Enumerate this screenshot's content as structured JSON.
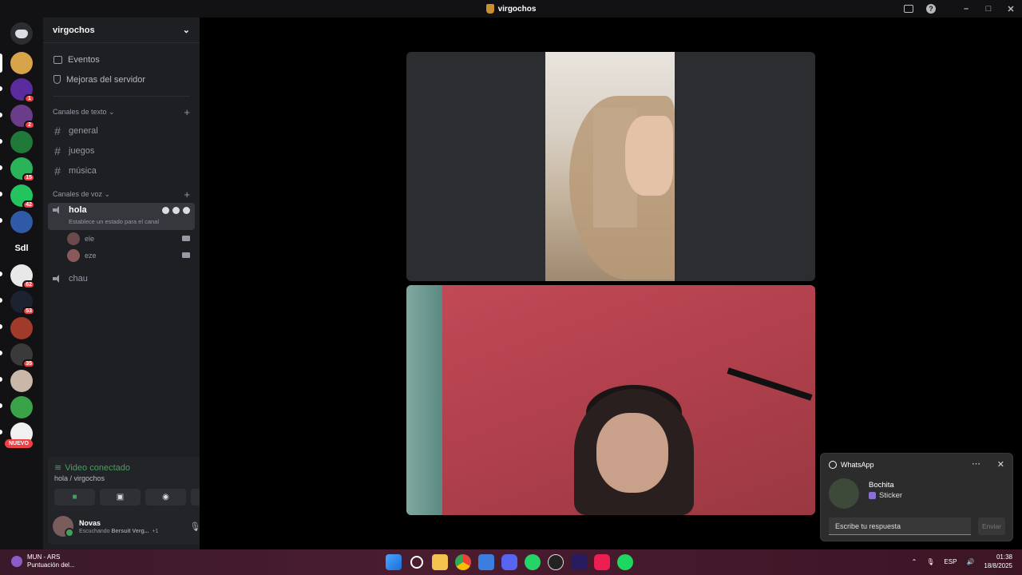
{
  "window": {
    "title": "virgochos"
  },
  "servers": {
    "badges": [
      "1",
      "2",
      "15",
      "42",
      "62",
      "53",
      "35"
    ],
    "text_server": "Sdl",
    "new_label": "NUEVO"
  },
  "sidebar": {
    "server_name": "virgochos",
    "nav": [
      {
        "label": "Eventos"
      },
      {
        "label": "Mejoras del servidor"
      }
    ],
    "text_category": "Canales de texto",
    "text_channels": [
      "general",
      "juegos",
      "música"
    ],
    "voice_category": "Canales de voz",
    "active_voice": {
      "name": "hola",
      "status": "Establece un estado para el canal"
    },
    "voice_users": [
      "ele",
      "eze"
    ],
    "voice_channel2": "chau"
  },
  "voice_panel": {
    "title": "Video conectado",
    "subtitle": "hola / virgochos",
    "user_name": "Novas",
    "user_status_prefix": "Escuchando",
    "user_status_track": "Bersuit Verg...",
    "user_status_extra": "+1"
  },
  "toast": {
    "app": "WhatsApp",
    "sender": "Bochita",
    "message": "Sticker",
    "input_placeholder": "Escribe tu respuesta",
    "send_label": "Enviar"
  },
  "taskbar": {
    "weather_title": "MUN - ARS",
    "weather_sub": "Puntuación del...",
    "lang": "ESP",
    "time": "01:38",
    "date": "18/8/2025"
  },
  "colors": {
    "accent_green": "#43a25a",
    "badge_red": "#f23f43"
  }
}
